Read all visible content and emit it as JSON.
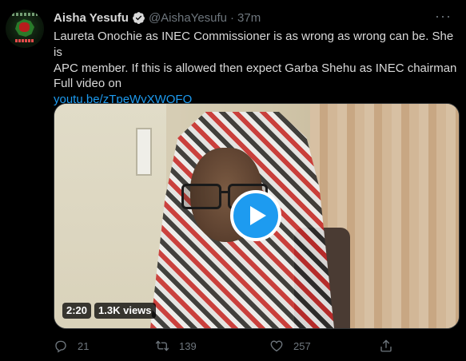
{
  "tweet": {
    "author_name": "Aisha Yesufu",
    "handle": "@AishaYesufu",
    "separator": "·",
    "time": "37m",
    "text_lines": [
      "Laureta Onochie as INEC Commissioner is as wrong as wrong can be. She is",
      "APC member. If this is allowed then expect Garba Shehu as INEC chairman",
      "Full video on"
    ],
    "link": "youtu.be/zTpeWyXWOFQ"
  },
  "media": {
    "duration": "2:20",
    "views": "1.3K views"
  },
  "actions": {
    "reply_count": "21",
    "retweet_count": "139",
    "like_count": "257"
  },
  "colors": {
    "background": "#000000",
    "text": "#d9d9d9",
    "secondary": "#6e767d",
    "accent": "#1d9bf0"
  },
  "icons": {
    "verified": "verified-badge-icon",
    "more": "more-options-icon",
    "play": "play-icon",
    "reply": "reply-icon",
    "retweet": "retweet-icon",
    "like": "heart-icon",
    "share": "share-icon"
  }
}
